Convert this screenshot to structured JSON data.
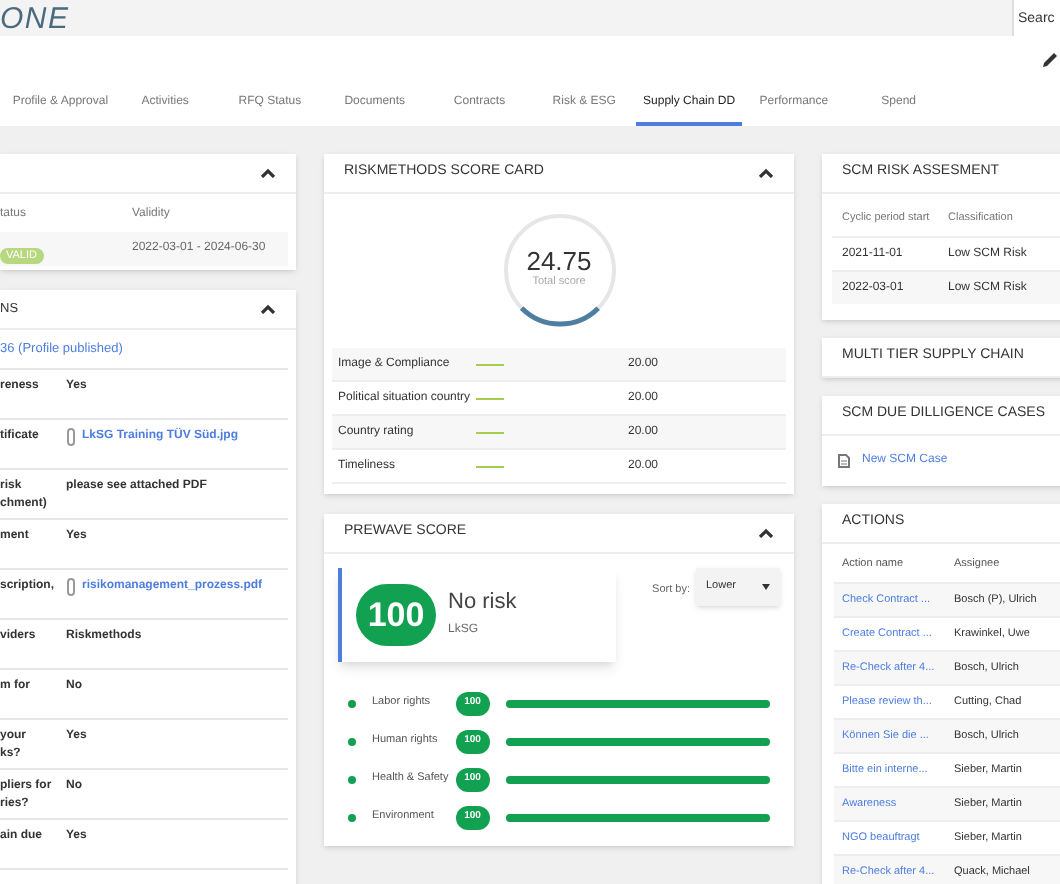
{
  "logo": "ONE",
  "search": {
    "placeholder": "Searc"
  },
  "tabs": [
    {
      "label": "Profile & Approval",
      "selected": false
    },
    {
      "label": "Activities",
      "selected": false
    },
    {
      "label": "RFQ Status",
      "selected": false
    },
    {
      "label": "Documents",
      "selected": false
    },
    {
      "label": "Contracts",
      "selected": false
    },
    {
      "label": "Risk & ESG",
      "selected": false
    },
    {
      "label": "Supply Chain DD",
      "selected": true
    },
    {
      "label": "Performance",
      "selected": false
    },
    {
      "label": "Spend",
      "selected": false
    }
  ],
  "certificate_panel": {
    "columns": [
      "tatus",
      "Validity"
    ],
    "rows": [
      {
        "status": "VALID",
        "validity": "2022-03-01 - 2024-06-30"
      }
    ]
  },
  "questions_panel": {
    "title": "NS",
    "link": "36 (Profile published)",
    "rows": [
      {
        "label": "reness",
        "kind": "text",
        "value": "Yes"
      },
      {
        "label": "tificate",
        "kind": "file",
        "value": "LkSG Training TÜV Süd.jpg"
      },
      {
        "label": "risk\nchment)",
        "kind": "text",
        "value": "please see attached PDF"
      },
      {
        "label": "ment",
        "kind": "text",
        "value": "Yes"
      },
      {
        "label": "scription,",
        "kind": "file",
        "value": "risikomanagement_prozess.pdf"
      },
      {
        "label": "viders",
        "kind": "text",
        "value": "Riskmethods"
      },
      {
        "label": "m for",
        "kind": "text",
        "value": "No"
      },
      {
        "label": "your\nks?",
        "kind": "text",
        "value": "Yes"
      },
      {
        "label": "pliers for\nries?",
        "kind": "text",
        "value": "No"
      },
      {
        "label": "ain due",
        "kind": "text",
        "value": "Yes"
      }
    ]
  },
  "score_card": {
    "title": "RISKMETHODS SCORE CARD",
    "score": "24.75",
    "score_label": "Total score",
    "level": 0.25,
    "rows": [
      {
        "name": "Image & Compliance",
        "value": "20.00"
      },
      {
        "name": "Political situation country",
        "value": "20.00"
      },
      {
        "name": "Country rating",
        "value": "20.00"
      },
      {
        "name": "Timeliness",
        "value": "20.00"
      }
    ]
  },
  "prewave": {
    "title": "PREWAVE SCORE",
    "score": "100",
    "risk": "No risk",
    "category": "LkSG",
    "sort_label": "Sort by:",
    "sort_value": "Lower",
    "rows": [
      {
        "name": "Labor rights",
        "score": "100",
        "level": 1
      },
      {
        "name": "Human rights",
        "score": "100",
        "level": 1
      },
      {
        "name": "Health & Safety",
        "score": "100",
        "level": 1
      },
      {
        "name": "Environment",
        "score": "100",
        "level": 1
      }
    ]
  },
  "scm_risk": {
    "title": "SCM RISK ASSESMENT",
    "columns": [
      "Cyclic period start",
      "Classification"
    ],
    "rows": [
      {
        "start": "2021-11-01",
        "classification": "Low SCM Risk"
      },
      {
        "start": "2022-03-01",
        "classification": "Low SCM Risk"
      }
    ]
  },
  "multi_tier": {
    "title": "MULTI TIER SUPPLY CHAIN"
  },
  "due_diligence": {
    "title": "SCM DUE DILLIGENCE CASES",
    "link": "New SCM Case"
  },
  "actions": {
    "title": "ACTIONS",
    "columns": [
      "Action name",
      "Assignee"
    ],
    "rows": [
      {
        "name": "Check Contract ...",
        "assignee": "Bosch (P), Ulrich"
      },
      {
        "name": "Create Contract ...",
        "assignee": "Krawinkel, Uwe"
      },
      {
        "name": "Re-Check after 4...",
        "assignee": "Bosch, Ulrich"
      },
      {
        "name": "Please review th...",
        "assignee": "Cutting, Chad"
      },
      {
        "name": "Können Sie die ...",
        "assignee": "Bosch, Ulrich"
      },
      {
        "name": "Bitte ein interne...",
        "assignee": "Sieber, Martin"
      },
      {
        "name": "Awareness",
        "assignee": "Sieber, Martin"
      },
      {
        "name": "NGO beauftragt",
        "assignee": "Sieber, Martin"
      },
      {
        "name": "Re-Check after 4...",
        "assignee": "Quack, Michael"
      }
    ]
  }
}
